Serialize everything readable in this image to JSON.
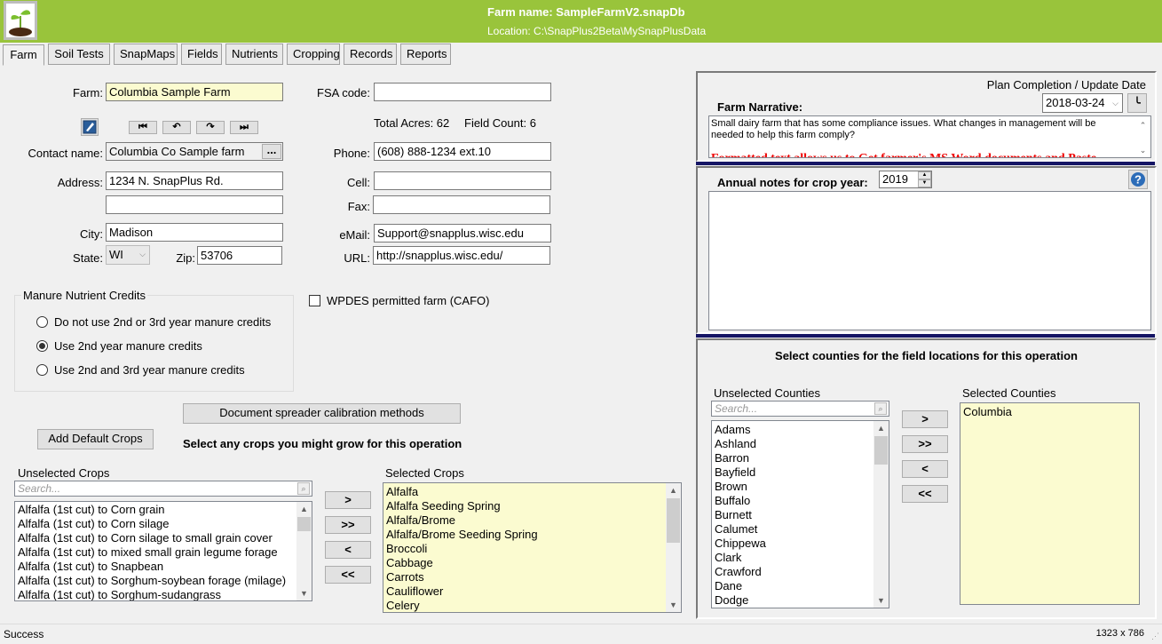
{
  "header": {
    "farm_title": "Farm name: SampleFarmV2.snapDb",
    "location": "Location: C:\\SnapPlus2Beta\\MySnapPlusData",
    "logo_icon": "seedling-icon"
  },
  "tabs": [
    {
      "label": "Farm",
      "active": true
    },
    {
      "label": "Soil Tests"
    },
    {
      "label": "SnapMaps"
    },
    {
      "label": "Fields"
    },
    {
      "label": "Nutrients"
    },
    {
      "label": "Cropping"
    },
    {
      "label": "Records"
    },
    {
      "label": "Reports"
    }
  ],
  "farm_form": {
    "farm_label": "Farm:",
    "farm_value": "Columbia Sample Farm",
    "fsa_label": "FSA code:",
    "fsa_value": "",
    "total_acres": "Total Acres: 62",
    "field_count": "Field Count: 6",
    "edit_icon": "edit-note-icon",
    "nav": {
      "first": "⏮",
      "prev": "↶",
      "next": "↷",
      "last": "⏭"
    },
    "contact_label": "Contact name:",
    "contact_value": "Columbia Co Sample farm",
    "contact_browse": "...",
    "address_label": "Address:",
    "address1": "1234 N. SnapPlus Rd.",
    "address2": "",
    "city_label": "City:",
    "city": "Madison",
    "state_label": "State:",
    "state": "WI",
    "zip_label": "Zip:",
    "zip": "53706",
    "phone_label": "Phone:",
    "phone": "(608) 888-1234 ext.10",
    "cell_label": "Cell:",
    "cell": "",
    "fax_label": "Fax:",
    "fax": "",
    "email_label": "eMail:",
    "email": "Support@snapplus.wisc.edu",
    "url_label": "URL:",
    "url": "http://snapplus.wisc.edu/"
  },
  "manure_credits": {
    "title": "Manure Nutrient Credits",
    "options": [
      {
        "label": "Do not use 2nd or 3rd year manure credits",
        "checked": false
      },
      {
        "label": "Use 2nd year manure credits",
        "checked": true
      },
      {
        "label": "Use 2nd and 3rd year manure credits",
        "checked": false
      }
    ]
  },
  "wpdes": {
    "label": "WPDES permitted farm (CAFO)",
    "checked": false
  },
  "buttons": {
    "document_spreader": "Document spreader calibration methods",
    "add_default_crops": "Add Default Crops",
    "move_right": ">",
    "move_all_right": ">>",
    "move_left": "<",
    "move_all_left": "<<"
  },
  "crops": {
    "heading": "Select any crops you might grow for this operation",
    "unselected_label": "Unselected Crops",
    "search_placeholder": "Search...",
    "unselected": [
      "Alfalfa (1st cut) to Corn grain",
      "Alfalfa (1st cut) to Corn silage",
      "Alfalfa (1st cut) to Corn silage to small grain cover",
      "Alfalfa (1st cut) to mixed small grain legume forage",
      "Alfalfa (1st cut) to Snapbean",
      "Alfalfa (1st cut) to Sorghum-soybean forage (milage)",
      "Alfalfa (1st cut) to Sorghum-sudangrass"
    ],
    "selected_label": "Selected Crops",
    "selected": [
      "Alfalfa",
      "Alfalfa Seeding Spring",
      "Alfalfa/Brome",
      "Alfalfa/Brome Seeding Spring",
      "Broccoli",
      "Cabbage",
      "Carrots",
      "Cauliflower",
      "Celery"
    ]
  },
  "narrative": {
    "plan_date_label": "Plan Completion / Update Date",
    "plan_date": "2018-03-24",
    "label": "Farm Narrative:",
    "text": "Small dairy farm that has some compliance issues.  What changes in management will be needed to help this farm comply?",
    "red_text": "Formatted text allows us to Get farmer's MS Word documents and Paste"
  },
  "annual_notes": {
    "label": "Annual notes for crop year:",
    "year": "2019",
    "text": ""
  },
  "counties": {
    "heading": "Select counties for the field locations for this operation",
    "unselected_label": "Unselected Counties",
    "search_placeholder": "Search...",
    "unselected": [
      "Adams",
      "Ashland",
      "Barron",
      "Bayfield",
      "Brown",
      "Buffalo",
      "Burnett",
      "Calumet",
      "Chippewa",
      "Clark",
      "Crawford",
      "Dane",
      "Dodge"
    ],
    "selected_label": "Selected Counties",
    "selected": [
      "Columbia"
    ]
  },
  "status_bar": {
    "status": "Success",
    "dimensions": "1323 x 786"
  }
}
